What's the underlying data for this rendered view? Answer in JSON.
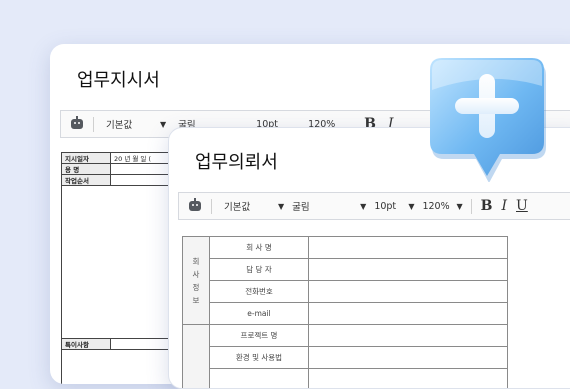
{
  "back_doc": {
    "title": "업무지시서",
    "toolbar": {
      "style": "기본값",
      "font": "굴림",
      "size": "10pt",
      "zoom": "120%",
      "bold": "B",
      "italic": "I"
    },
    "rows": [
      "지시일자",
      "용 명",
      "작업순서"
    ],
    "date_value": "20 년 월 일 (",
    "bottom_label": "특이사항"
  },
  "front_doc": {
    "title": "업무의뢰서",
    "toolbar": {
      "style": "기본값",
      "font": "굴림",
      "size": "10pt",
      "zoom": "120%",
      "bold": "B",
      "italic": "I",
      "underline": "U"
    },
    "section1_label": "회\n사\n정\n보",
    "rows": [
      "회 사 명",
      "담 당 자",
      "전화번호",
      "e-mail",
      "프로젝트 명",
      "환경 및 사용법"
    ]
  },
  "colors": {
    "background": "#e4eaf9",
    "accent": "#6fb8f2",
    "plus": "#ffffff"
  },
  "icons": [
    "robot-icon",
    "plus-bubble-icon"
  ]
}
